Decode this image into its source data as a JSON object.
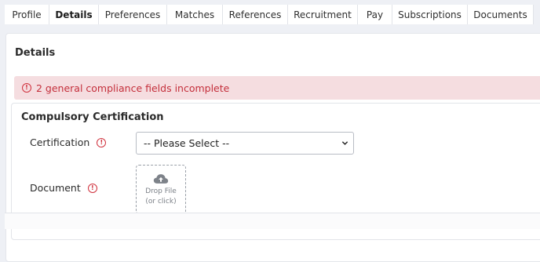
{
  "tabs": [
    {
      "label": "Profile",
      "active": false
    },
    {
      "label": "Details",
      "active": true
    },
    {
      "label": "Preferences",
      "active": false
    },
    {
      "label": "Matches",
      "active": false
    },
    {
      "label": "References",
      "active": false
    },
    {
      "label": "Recruitment",
      "active": false
    },
    {
      "label": "Pay",
      "active": false
    },
    {
      "label": "Subscriptions",
      "active": false
    },
    {
      "label": "Documents",
      "active": false
    }
  ],
  "page": {
    "title": "Details"
  },
  "alert": {
    "text": "2 general compliance fields incomplete",
    "icon": "warning-circle-icon",
    "color": "#c42f3b",
    "background": "#f5dde0"
  },
  "section": {
    "title": "Compulsory Certification",
    "certification": {
      "label": "Certification",
      "selected": "-- Please Select --"
    },
    "document": {
      "label": "Document",
      "dropzone_line1": "Drop File",
      "dropzone_line2": "(or click)",
      "icon": "cloud-upload-icon"
    }
  }
}
